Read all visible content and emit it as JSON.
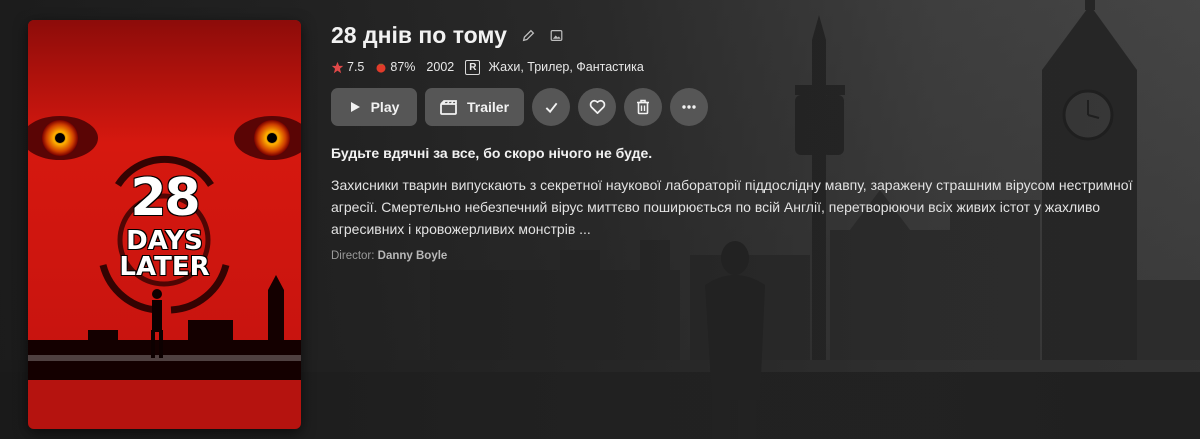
{
  "movie": {
    "title": "28 днів по тому",
    "poster": {
      "line1": "28",
      "line2": "DAYS",
      "line3": "LATER"
    },
    "meta": {
      "rating": "7.5",
      "tomatometer": "87%",
      "year": "2002",
      "content_rating": "R",
      "genres": "Жахи, Трилер, Фантастика"
    },
    "tagline": "Будьте вдячні за все, бо скоро нічого не буде.",
    "overview": "Захисники тварин випускають з секретної наукової лабораторії піддослідну мавпу, заражену страшним вірусом нестримної агресії. Смертельно небезпечний вірус миттєво поширюється по всій Англії, перетворюючи всіх живих істот у жахливо агресивних і кровожерливих монстрів ...",
    "director_label": "Director:",
    "director_name": "Danny Boyle"
  },
  "actions": {
    "play_label": "Play",
    "trailer_label": "Trailer"
  },
  "icons": {
    "edit": "pencil-icon",
    "image": "image-icon",
    "star": "star-icon",
    "tomato": "tomato-icon",
    "play": "play-icon",
    "trailer": "film-icon",
    "watched": "check-icon",
    "favorite": "heart-icon",
    "delete": "trash-icon",
    "more": "more-dots-icon"
  },
  "colors": {
    "button_bg": "#565656",
    "poster_red": "#c8140f",
    "star": "#e04848",
    "tomato": "#e23b2a"
  }
}
